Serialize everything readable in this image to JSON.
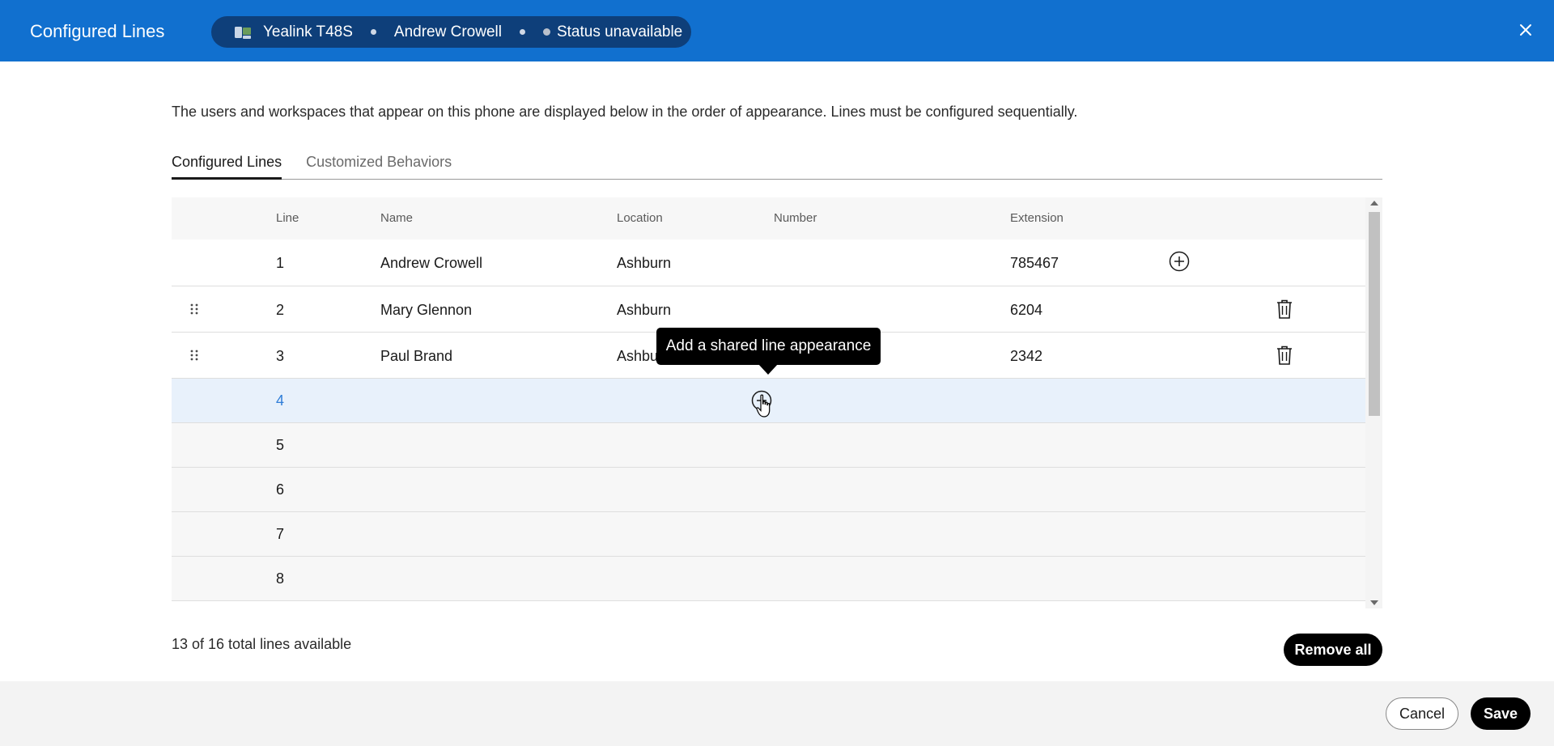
{
  "header": {
    "title": "Configured Lines",
    "device": "Yealink T48S",
    "user": "Andrew Crowell",
    "status": "Status unavailable"
  },
  "description": "The users and workspaces that appear on this phone are displayed below in the order of appearance. Lines must be configured sequentially.",
  "tabs": [
    {
      "label": "Configured Lines",
      "active": true
    },
    {
      "label": "Customized Behaviors",
      "active": false
    }
  ],
  "table": {
    "headers": {
      "line": "Line",
      "name": "Name",
      "location": "Location",
      "number": "Number",
      "extension": "Extension"
    },
    "rows": [
      {
        "line": "1",
        "name": "Andrew Crowell",
        "location": "Ashburn",
        "number": "",
        "extension": "785467"
      },
      {
        "line": "2",
        "name": "Mary Glennon",
        "location": "Ashburn",
        "number": "",
        "extension": "6204"
      },
      {
        "line": "3",
        "name": "Paul Brand",
        "location": "Ashburn",
        "number": "",
        "extension": "2342"
      },
      {
        "line": "4"
      },
      {
        "line": "5"
      },
      {
        "line": "6"
      },
      {
        "line": "7"
      },
      {
        "line": "8"
      }
    ]
  },
  "tooltip": "Add a shared line appearance",
  "footer": {
    "lines_available": "13 of 16 total lines available",
    "remove_all": "Remove all",
    "cancel": "Cancel",
    "save": "Save"
  },
  "colors": {
    "header_bg": "#1170cf",
    "pill_bg": "#0e3f7a",
    "hover_row": "#e8f1fb",
    "line_highlight": "#2f7ed8"
  }
}
